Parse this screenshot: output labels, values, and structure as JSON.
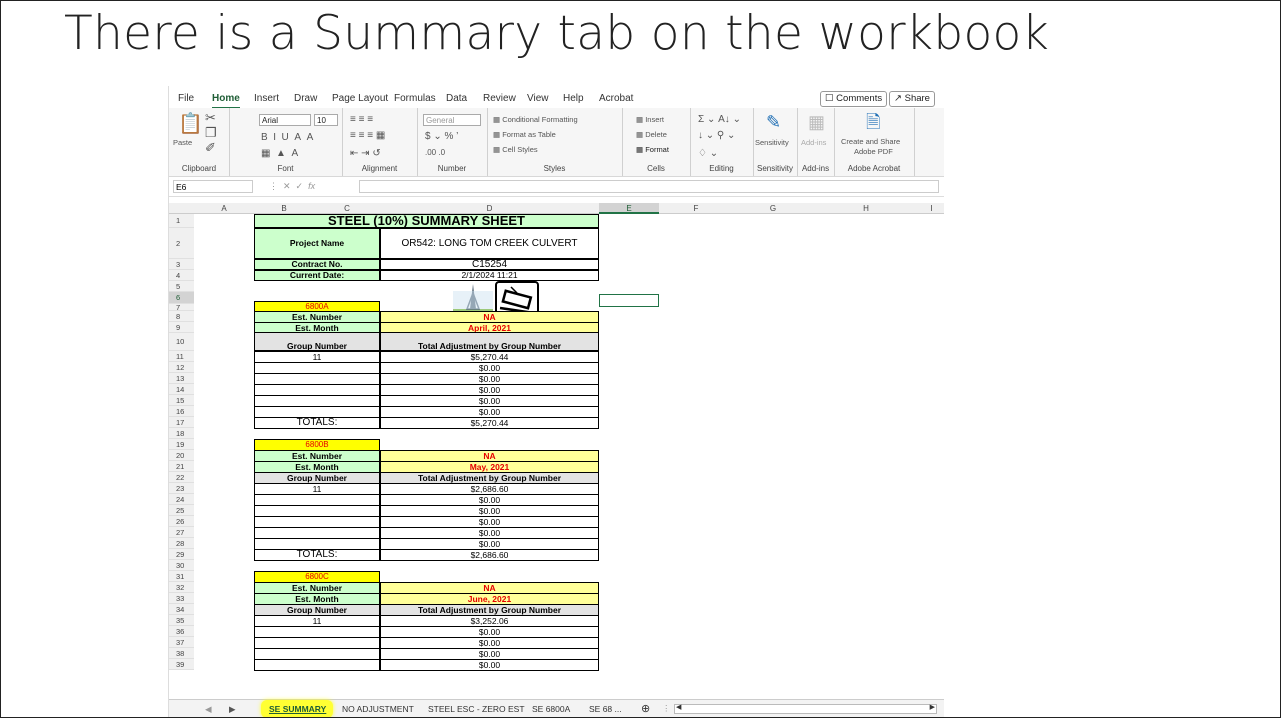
{
  "slide": {
    "title": "There is a Summary tab on the workbook"
  },
  "ribbon": {
    "tabs": [
      "File",
      "Home",
      "Insert",
      "Draw",
      "Page Layout",
      "Formulas",
      "Data",
      "Review",
      "View",
      "Help",
      "Acrobat"
    ],
    "comments_label": "Comments",
    "share_label": "Share",
    "font_name": "Arial",
    "font_size": "10",
    "number_format": "General",
    "paste_label": "Paste",
    "conditional_formatting": "Conditional Formatting",
    "format_as_table": "Format as Table",
    "cell_styles": "Cell Styles",
    "insert_label": "Insert",
    "delete_label": "Delete",
    "format_label": "Format",
    "sensitivity_label": "Sensitivity",
    "addins_label": "Add-ins",
    "create_share_pdf_line1": "Create and Share",
    "create_share_pdf_line2": "Adobe PDF",
    "groups": [
      "Clipboard",
      "Font",
      "Alignment",
      "Number",
      "Styles",
      "Cells",
      "Editing",
      "Sensitivity",
      "Add-ins",
      "Adobe Acrobat"
    ]
  },
  "formula_bar": {
    "name_box": "E6",
    "fx": "fx"
  },
  "columns": [
    "A",
    "B",
    "C",
    "D",
    "E",
    "F",
    "G",
    "H",
    "I"
  ],
  "rows": [
    "1",
    "2",
    "3",
    "4",
    "5",
    "6",
    "7",
    "8",
    "9",
    "10",
    "11",
    "12",
    "13",
    "14",
    "15",
    "16",
    "17",
    "18",
    "19",
    "20",
    "21",
    "22",
    "23",
    "24",
    "25",
    "26",
    "27",
    "28",
    "29",
    "30",
    "31",
    "32",
    "33",
    "34",
    "35",
    "36",
    "37",
    "38",
    "39"
  ],
  "sheet": {
    "title": "STEEL  (10%) SUMMARY SHEET",
    "project_name_label": "Project Name",
    "project_name": "OR542: LONG TOM CREEK CULVERT",
    "contract_no_label": "Contract No.",
    "contract_no": "C15254",
    "current_date_label": "Current Date:",
    "current_date": "2/1/2024 11:21",
    "est_number_label": "Est. Number",
    "est_month_label": "Est. Month",
    "group_number_label": "Group Number",
    "total_adj_label": "Total Adjustment by Group Number",
    "totals_label": "TOTALS:",
    "blocks": [
      {
        "code": "6800A",
        "est_number": "NA",
        "est_month": "April, 2021",
        "group": "11",
        "values": [
          "$5,270.44",
          "$0.00",
          "$0.00",
          "$0.00",
          "$0.00",
          "$0.00"
        ],
        "total": "$5,270.44"
      },
      {
        "code": "6800B",
        "est_number": "NA",
        "est_month": "May, 2021",
        "group": "11",
        "values": [
          "$2,686.60",
          "$0.00",
          "$0.00",
          "$0.00",
          "$0.00",
          "$0.00"
        ],
        "total": "$2,686.60"
      },
      {
        "code": "6800C",
        "est_number": "NA",
        "est_month": "June, 2021",
        "group": "11",
        "values": [
          "$3,252.06",
          "$0.00",
          "$0.00",
          "$0.00",
          "$0.00"
        ]
      }
    ]
  },
  "sheet_tabs": [
    "SE SUMMARY",
    "NO ADJUSTMENT",
    "STEEL ESC - ZERO EST",
    "SE 6800A",
    "SE 68 ..."
  ],
  "colors": {
    "excel_green": "#217346",
    "highlight": "#ffff33",
    "header_green": "#ccffcc",
    "value_yellow": "#ffff99",
    "code_yellow": "#ffff00",
    "red_text": "#e60000"
  }
}
